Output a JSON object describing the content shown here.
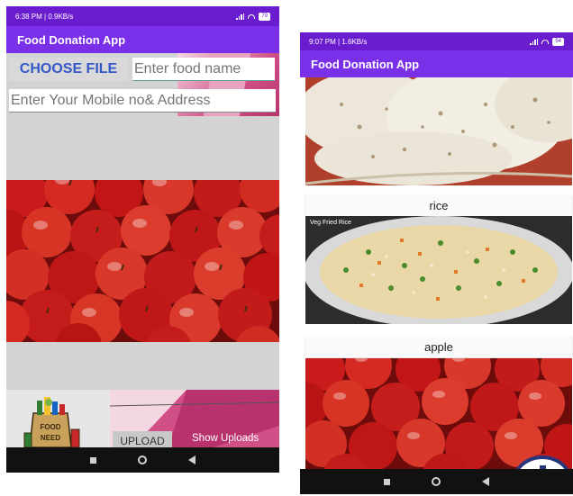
{
  "phone1": {
    "status_time": "6:38 PM | 0.9KB/s",
    "battery": "79",
    "app_title": "Food Donation App",
    "choose_file_label": "CHOOSE FILE",
    "food_name_placeholder": "Enter food name",
    "address_placeholder": "Enter Your Mobile no& Address",
    "upload_label": "UPLOAD",
    "show_uploads_label": "Show Uploads",
    "logo_text": "FOOD NEED"
  },
  "phone2": {
    "status_time": "9:07 PM | 1.6KB/s",
    "battery": "54",
    "app_title": "Food Donation App",
    "items": [
      {
        "label": "",
        "image": "chapati"
      },
      {
        "label": "rice",
        "image": "Veg Fried Rice"
      },
      {
        "label": "apple",
        "image": "apples"
      }
    ],
    "rice_image_caption": "Veg Fried Rice"
  },
  "colors": {
    "status_bar": "#6a1ccf",
    "app_bar": "#7a2fe8",
    "choose_file_text": "#3558c7",
    "fab": "#27357a",
    "pink_accent": "#cf4f86"
  }
}
